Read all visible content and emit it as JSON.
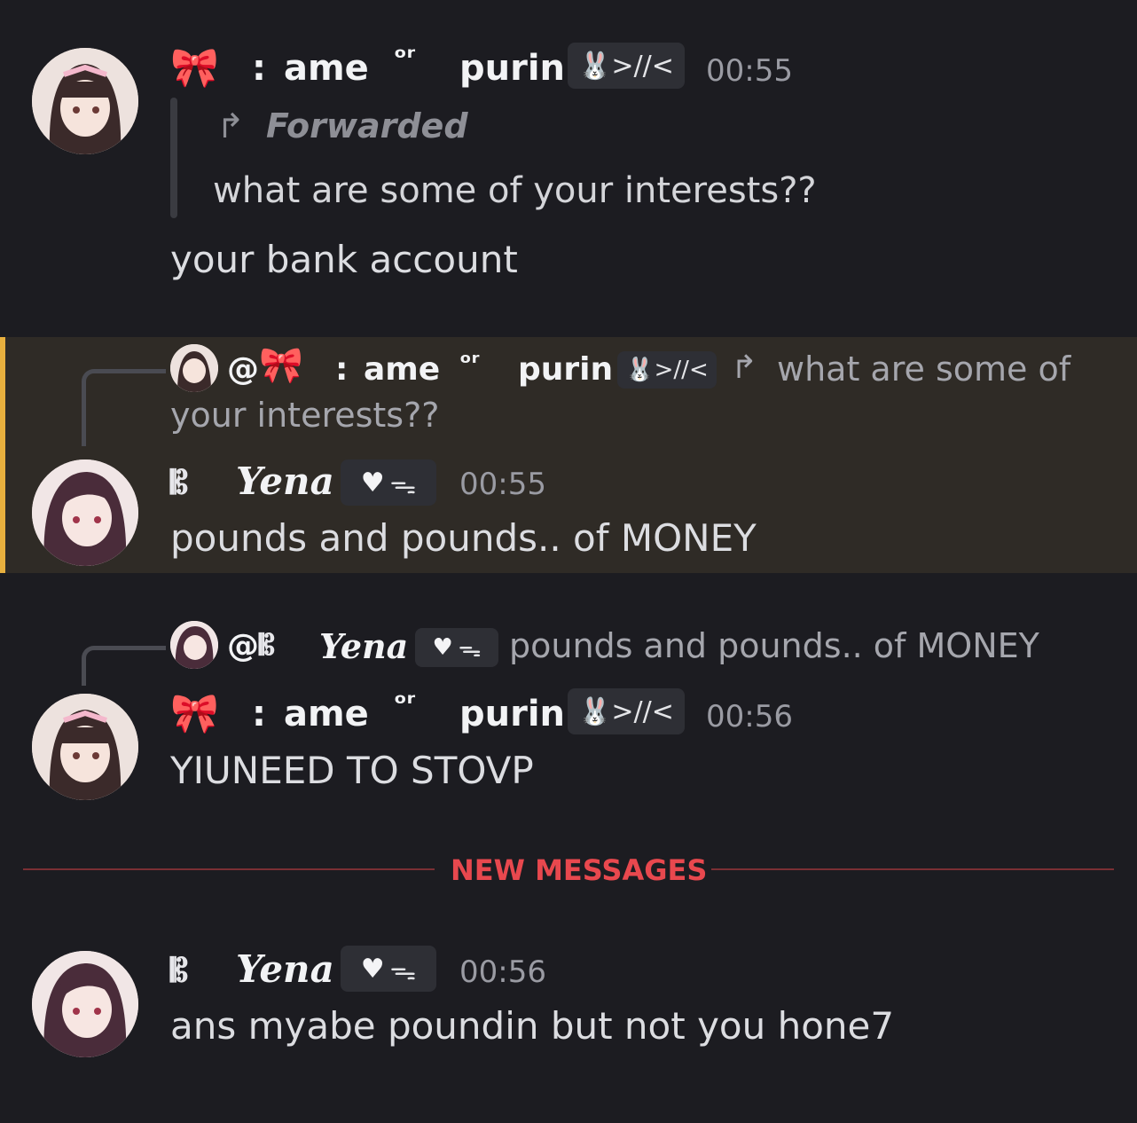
{
  "messages": [
    {
      "author": "ame",
      "author_prefix": ":",
      "author_mid": "ᵒʳ",
      "author_suffix": "purin",
      "tag": ">//<",
      "time": "00:55",
      "forwarded_label": "Forwarded",
      "forwarded_text": "what are some of your interests??",
      "text": "your bank account"
    },
    {
      "reply_to": {
        "at": "@",
        "author_prefix": ":",
        "author": "ame",
        "author_mid": "ᵒʳ",
        "author_suffix": "purin",
        "tag": ">//<",
        "text_line1": "what are some of",
        "text_line2": "your interests??"
      },
      "author_prefix": "𝄡",
      "author": "Yena",
      "tag": "ᯓ",
      "time": "00:55",
      "text": "pounds and pounds.. of MONEY"
    },
    {
      "reply_to": {
        "at": "@",
        "author_prefix": "𝄡",
        "author": "Yena",
        "tag": "ᯓ",
        "text": "pounds and pounds.. of MONEY"
      },
      "author": "ame",
      "author_prefix": ":",
      "author_mid": "ᵒʳ",
      "author_suffix": "purin",
      "tag": ">//<",
      "time": "00:56",
      "text": "YIUNEED TO STOVP"
    },
    {
      "author_prefix": "𝄡",
      "author": "Yena",
      "tag": "ᯓ",
      "time": "00:56",
      "text": "ans myabe poundin but not you hone7"
    }
  ],
  "divider": {
    "label": "NEW MESSAGES"
  },
  "colors": {
    "background": "#1c1c21",
    "highlight": "#2f2b26",
    "highlight_bar": "#e8b03e",
    "new_messages": "#e8484e"
  }
}
